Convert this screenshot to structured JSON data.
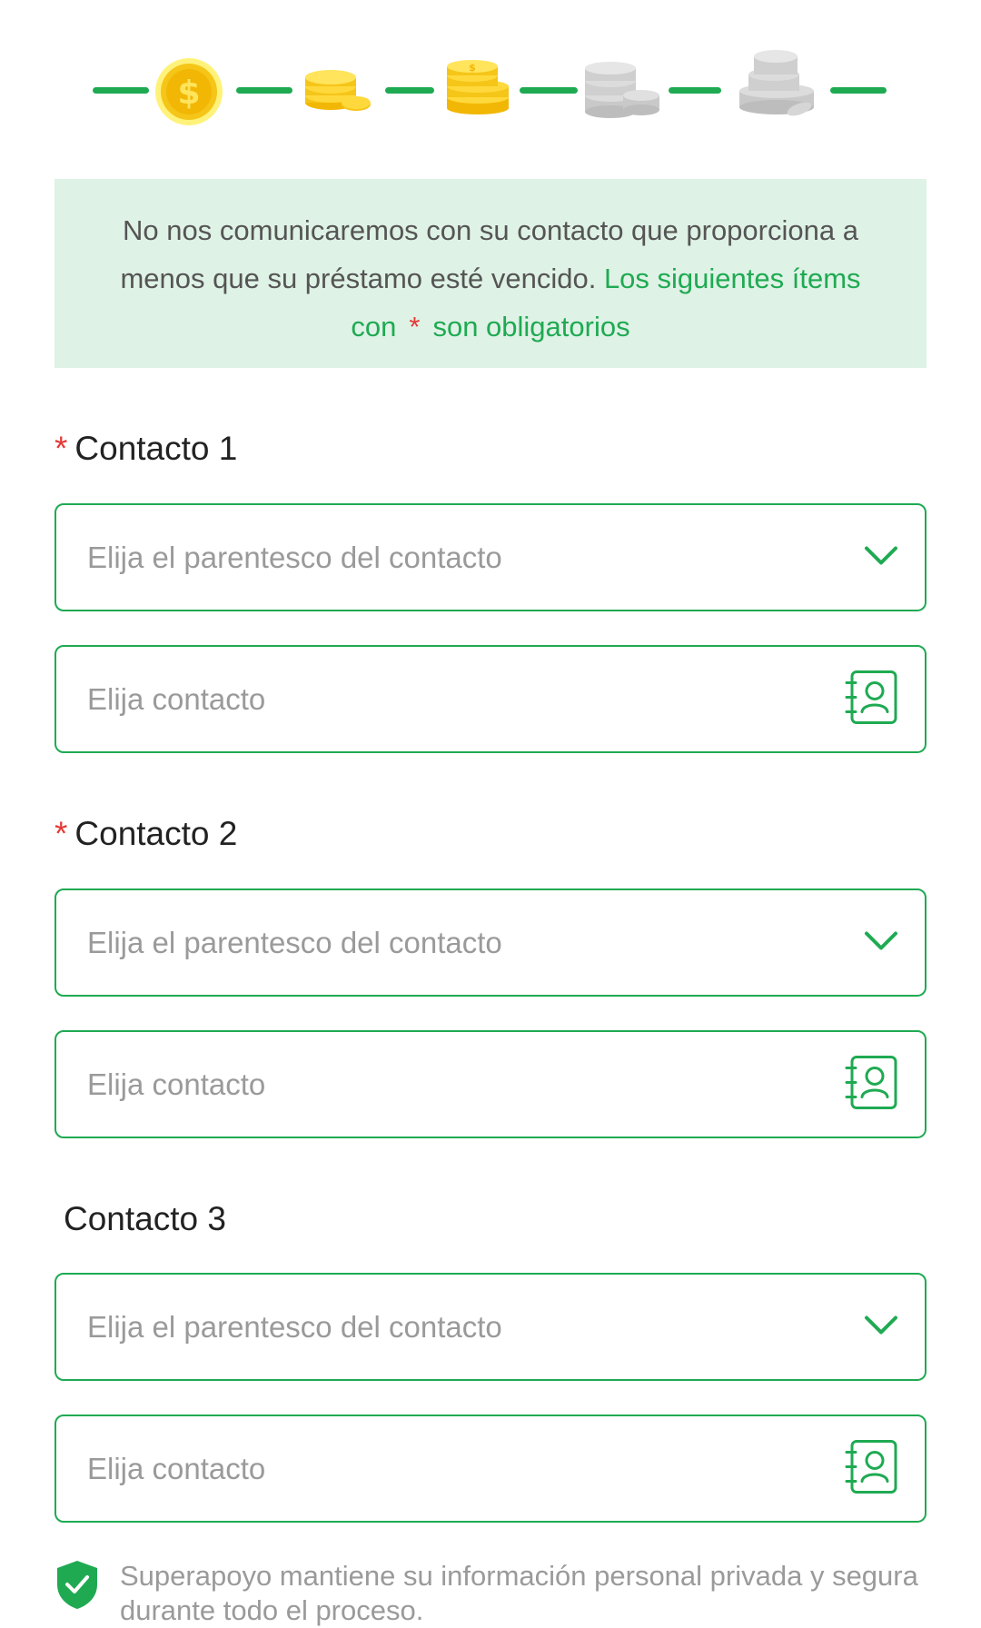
{
  "stepper": {
    "total_steps": 5,
    "current_step": 1,
    "accent_color": "#1faa52",
    "active_coin_color": "#f5c518",
    "inactive_coin_color": "#cfcfcf",
    "stages": [
      "coin-icon",
      "coin-stack-small-icon",
      "coin-stack-medium-icon",
      "coin-stack-large-icon",
      "coin-pile-icon"
    ]
  },
  "notice": {
    "text_main": "No nos comunicaremos con su contacto que proporciona a menos que su préstamo esté vencido.",
    "text_required_prefix": "Los siguientes ítems con",
    "required_marker": "*",
    "text_required_suffix": "son obligatorios"
  },
  "contacts": [
    {
      "title": "Contacto 1",
      "required_marker": "*",
      "relation_placeholder": "Elija el parentesco del contacto",
      "contact_placeholder": "Elija contacto"
    },
    {
      "title": "Contacto 2",
      "required_marker": "*",
      "relation_placeholder": "Elija el parentesco del contacto",
      "contact_placeholder": "Elija contacto"
    },
    {
      "title": "Contacto 3",
      "relation_placeholder": "Elija el parentesco del contacto",
      "contact_placeholder": "Elija contacto"
    }
  ],
  "privacy": {
    "text": "Superapoyo mantiene su información personal privada y segura durante todo el proceso."
  },
  "colors": {
    "brand_green": "#1faa52",
    "required_red": "#e53935",
    "notice_bg": "#dff2e6",
    "placeholder_gray": "#9a9a9a"
  }
}
